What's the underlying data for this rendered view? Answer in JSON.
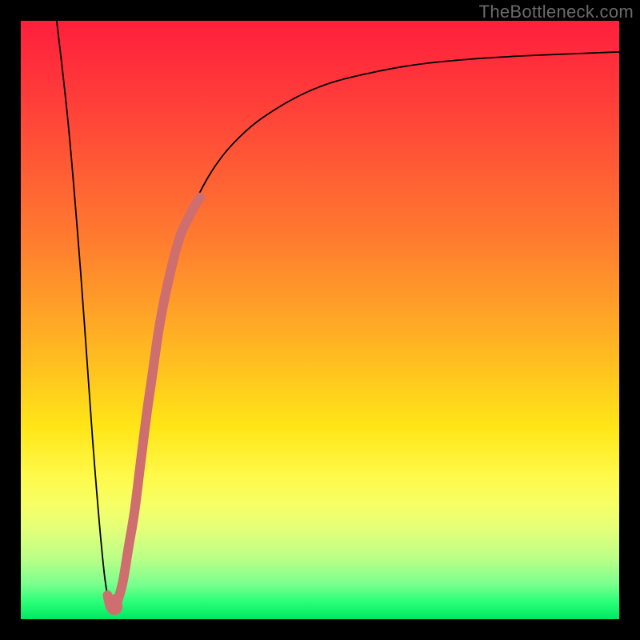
{
  "watermark": "TheBottleneck.com",
  "chart_data": {
    "type": "line",
    "title": "",
    "xlabel": "",
    "ylabel": "",
    "xlim": [
      0,
      100
    ],
    "ylim": [
      0,
      100
    ],
    "series": [
      {
        "name": "bottleneck-curve",
        "x": [
          6,
          8,
          10,
          12,
          13.5,
          14.5,
          15.5,
          17,
          19,
          21,
          23,
          25,
          28,
          32,
          37,
          43,
          50,
          58,
          67,
          78,
          90,
          100
        ],
        "y": [
          100,
          82,
          58,
          30,
          12,
          4,
          2,
          6,
          18,
          34,
          48,
          58,
          67,
          75,
          81,
          85.5,
          89,
          91.2,
          92.8,
          93.8,
          94.4,
          94.8
        ]
      }
    ],
    "highlight_segment": {
      "name": "your-config-range",
      "color": "#cf6e6e",
      "x": [
        16,
        17,
        18,
        19,
        20,
        21,
        22,
        23,
        24,
        25,
        26,
        27,
        28,
        29,
        30
      ],
      "y": [
        2.5,
        6,
        12,
        18,
        26,
        34,
        41,
        48,
        53.5,
        58,
        62,
        65,
        67,
        69,
        70.5
      ]
    },
    "highlight_hook": {
      "name": "optimum-marker",
      "color": "#cf6e6e",
      "x": [
        14.5,
        15,
        15.8,
        16.2,
        15.8
      ],
      "y": [
        4,
        2,
        1.5,
        2.2,
        3.4
      ]
    }
  }
}
